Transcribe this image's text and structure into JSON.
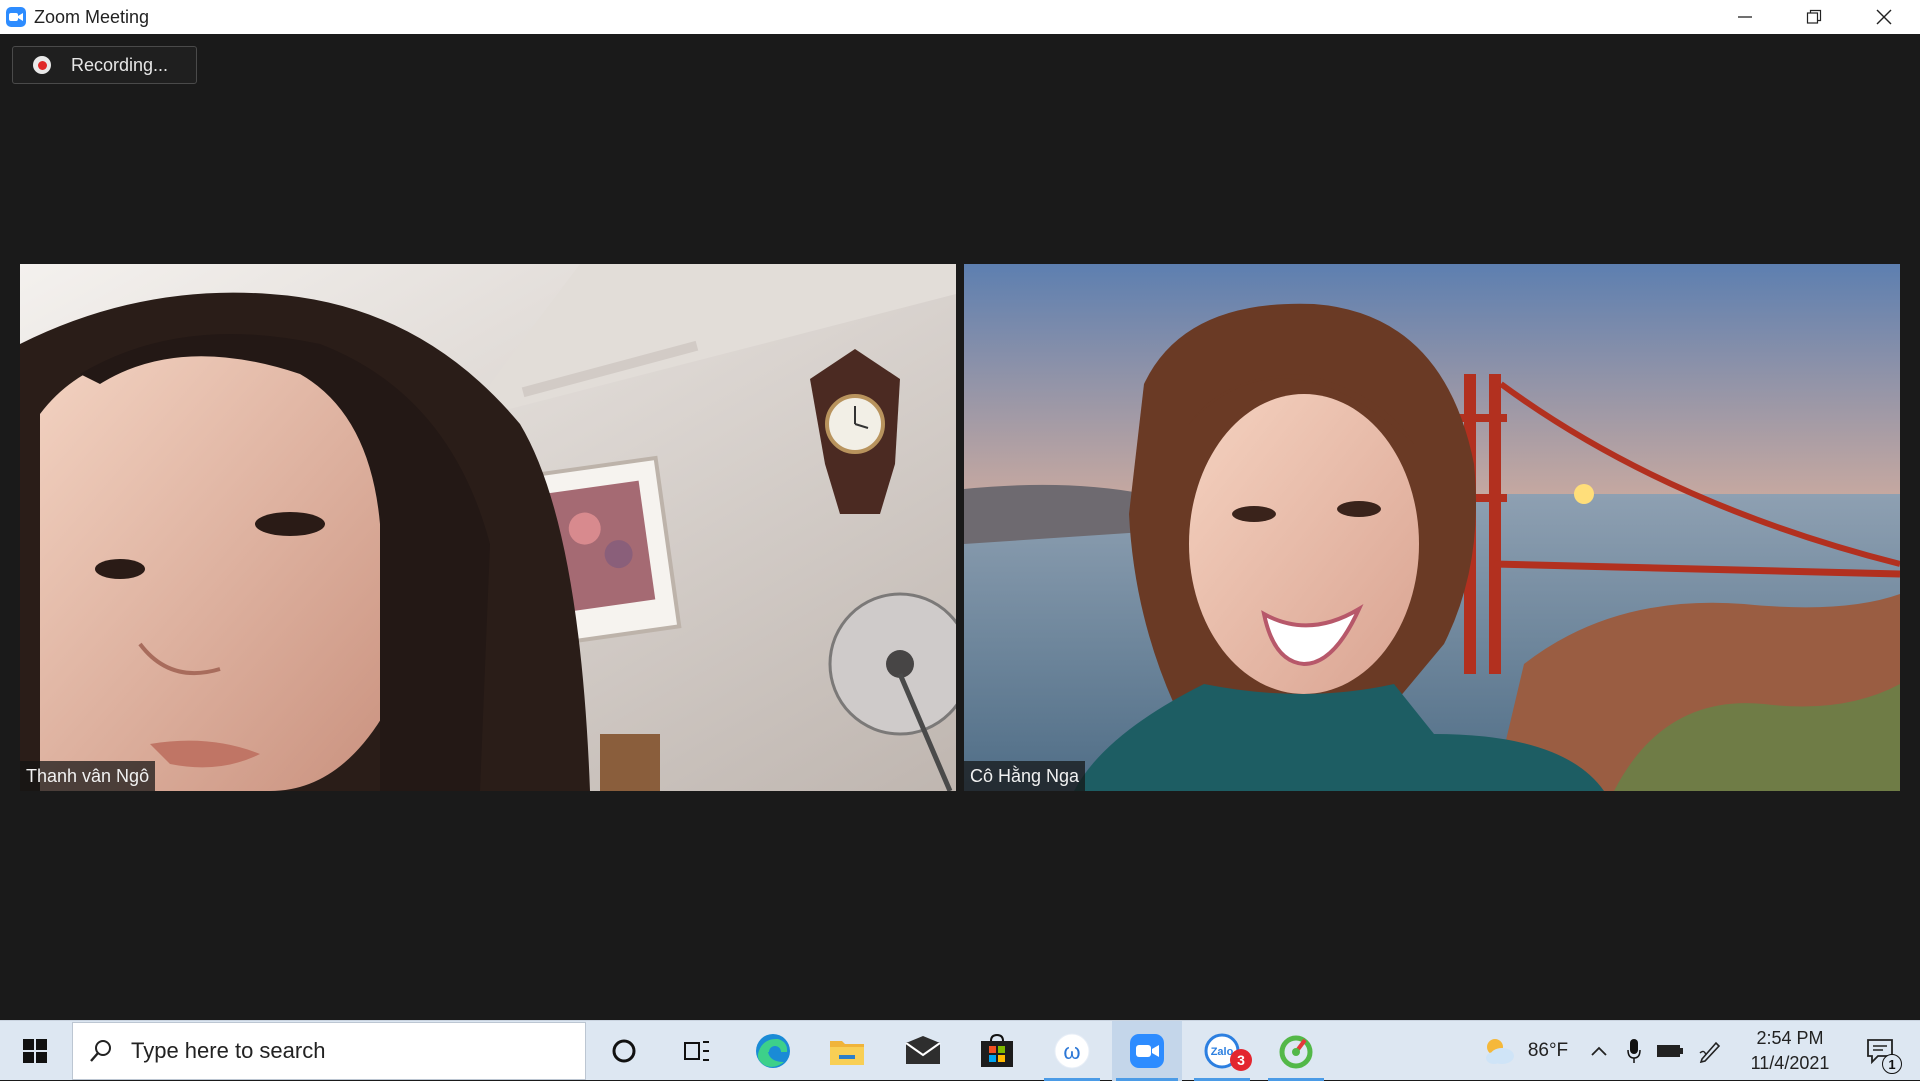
{
  "window": {
    "title": "Zoom Meeting",
    "controls": [
      "minimize",
      "restore",
      "close"
    ]
  },
  "recording": {
    "label": "Recording..."
  },
  "participants": [
    {
      "name": "Thanh vân Ngô"
    },
    {
      "name": "Cô Hằng Nga"
    }
  ],
  "taskbar": {
    "search_placeholder": "Type here to search",
    "apps": [
      "start-icon",
      "cortana-icon",
      "task-view-icon",
      "edge-icon",
      "file-explorer-icon",
      "mail-icon",
      "store-icon",
      "word-app-icon",
      "zoom-icon",
      "zalo-icon",
      "green-app-icon"
    ],
    "zalo_badge": "3",
    "weather_temp": "86°F",
    "time": "2:54 PM",
    "date": "11/4/2021",
    "notification_count": "1"
  },
  "colors": {
    "meeting_bg": "#1a1a1a",
    "zoom_blue": "#2d8cff",
    "record_red": "#e02828",
    "taskbar_bg": "#dde7f2"
  }
}
